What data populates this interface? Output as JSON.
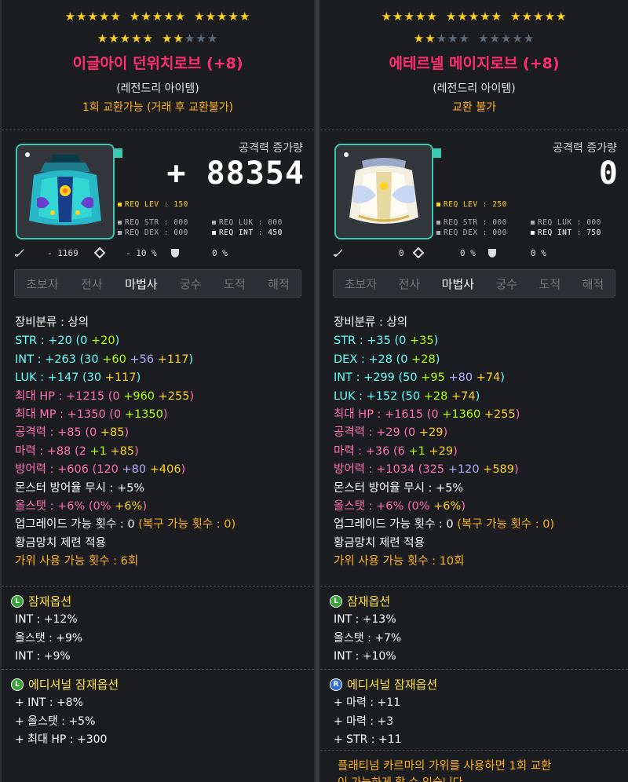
{
  "left": {
    "stars_row1_on": 15,
    "stars_row1_off": 0,
    "stars_row2_on": 7,
    "stars_row2_off": 3,
    "name": "이글아이 던위치로브 (+8)",
    "grade": "(레전드리 아이템)",
    "trade": "1회 교환가능 (거래 후 교환불가)",
    "atk_label": "공격력 증가량",
    "atk_value": "+ 88354",
    "req": {
      "lev": "REQ LEV : 150",
      "str": "REQ STR : 000",
      "luk": "REQ LUK : 000",
      "dex": "REQ DEX : 000",
      "int": "REQ INT : 450"
    },
    "mini": [
      "- 1169",
      "- 10 %",
      "0 %"
    ],
    "jobs": [
      "초보자",
      "전사",
      "마법사",
      "궁수",
      "도적",
      "해적"
    ],
    "stats": [
      [
        {
          "t": "장비분류 : 상의",
          "c": "white"
        }
      ],
      [
        {
          "t": "STR : +20 (0 ",
          "c": "cyan"
        },
        {
          "t": "+20",
          "c": "green"
        },
        {
          "t": ")",
          "c": "cyan"
        }
      ],
      [
        {
          "t": "INT : +263 (30 ",
          "c": "cyan"
        },
        {
          "t": "+60 ",
          "c": "green"
        },
        {
          "t": "+56 ",
          "c": "purple"
        },
        {
          "t": "+117",
          "c": "yellow"
        },
        {
          "t": ")",
          "c": "cyan"
        }
      ],
      [
        {
          "t": "LUK : +147 (30 ",
          "c": "cyan"
        },
        {
          "t": "+117",
          "c": "yellow"
        },
        {
          "t": ")",
          "c": "cyan"
        }
      ],
      [
        {
          "t": "최대 HP : +1215 (0 ",
          "c": "pink"
        },
        {
          "t": "+960 ",
          "c": "green"
        },
        {
          "t": "+255",
          "c": "yellow"
        },
        {
          "t": ")",
          "c": "pink"
        }
      ],
      [
        {
          "t": "최대 MP : +1350 (0 ",
          "c": "pink"
        },
        {
          "t": "+1350",
          "c": "green"
        },
        {
          "t": ")",
          "c": "pink"
        }
      ],
      [
        {
          "t": "공격력 : +85 (0 ",
          "c": "pink"
        },
        {
          "t": "+85",
          "c": "yellow"
        },
        {
          "t": ")",
          "c": "pink"
        }
      ],
      [
        {
          "t": "마력 : +88 (2 ",
          "c": "pink"
        },
        {
          "t": "+1 ",
          "c": "green"
        },
        {
          "t": "+85",
          "c": "yellow"
        },
        {
          "t": ")",
          "c": "pink"
        }
      ],
      [
        {
          "t": "방어력 : +606 (120 ",
          "c": "pink"
        },
        {
          "t": "+80 ",
          "c": "purple"
        },
        {
          "t": "+406",
          "c": "yellow"
        },
        {
          "t": ")",
          "c": "pink"
        }
      ],
      [
        {
          "t": "몬스터 방어율 무시 : +5%",
          "c": "white"
        }
      ],
      [
        {
          "t": "올스탯 : +6% (0% ",
          "c": "pink"
        },
        {
          "t": "+6%",
          "c": "yellow"
        },
        {
          "t": ")",
          "c": "pink"
        }
      ],
      [
        {
          "t": "업그레이드 가능 횟수 : 0 ",
          "c": "white"
        },
        {
          "t": "(복구 가능 횟수 : 0)",
          "c": "orange"
        }
      ],
      [
        {
          "t": "황금망치 제련 적용",
          "c": "white"
        }
      ],
      [
        {
          "t": "가위 사용 가능 횟수 : 6회",
          "c": "orange"
        }
      ]
    ],
    "potential_label": "잠재옵션",
    "potential_badge": "L",
    "potential": [
      "INT : +12%",
      "올스탯 : +9%",
      "INT : +9%"
    ],
    "additional_label": "에디셔널 잠재옵션",
    "additional_badge": "L",
    "additional": [
      "+ INT : +8%",
      "+ 올스탯 : +5%",
      "+ 최대 HP : +300"
    ]
  },
  "right": {
    "stars_row1_on": 15,
    "stars_row1_off": 0,
    "stars_row2_on": 2,
    "stars_row2_off": 8,
    "name": "에테르넬 메이지로브 (+8)",
    "grade": "(레전드리 아이템)",
    "trade": "교환 불가",
    "atk_label": "공격력 증가량",
    "atk_value": "0",
    "req": {
      "lev": "REQ LEV : 250",
      "str": "REQ STR : 000",
      "luk": "REQ LUK : 000",
      "dex": "REQ DEX : 000",
      "int": "REQ INT : 750"
    },
    "mini": [
      "0",
      "0 %",
      "0 %"
    ],
    "jobs": [
      "초보자",
      "전사",
      "마법사",
      "궁수",
      "도적",
      "해적"
    ],
    "stats": [
      [
        {
          "t": "장비분류 : 상의",
          "c": "white"
        }
      ],
      [
        {
          "t": "STR : +35 (0 ",
          "c": "cyan"
        },
        {
          "t": "+35",
          "c": "green"
        },
        {
          "t": ")",
          "c": "cyan"
        }
      ],
      [
        {
          "t": "DEX : +28 (0 ",
          "c": "cyan"
        },
        {
          "t": "+28",
          "c": "green"
        },
        {
          "t": ")",
          "c": "cyan"
        }
      ],
      [
        {
          "t": "INT : +299 (50 ",
          "c": "cyan"
        },
        {
          "t": "+95 ",
          "c": "green"
        },
        {
          "t": "+80 ",
          "c": "purple"
        },
        {
          "t": "+74",
          "c": "yellow"
        },
        {
          "t": ")",
          "c": "cyan"
        }
      ],
      [
        {
          "t": "LUK : +152 (50 ",
          "c": "cyan"
        },
        {
          "t": "+28 ",
          "c": "green"
        },
        {
          "t": "+74",
          "c": "yellow"
        },
        {
          "t": ")",
          "c": "cyan"
        }
      ],
      [
        {
          "t": "최대 HP : +1615 (0 ",
          "c": "pink"
        },
        {
          "t": "+1360 ",
          "c": "green"
        },
        {
          "t": "+255",
          "c": "yellow"
        },
        {
          "t": ")",
          "c": "pink"
        }
      ],
      [
        {
          "t": "공격력 : +29 (0 ",
          "c": "pink"
        },
        {
          "t": "+29",
          "c": "yellow"
        },
        {
          "t": ")",
          "c": "pink"
        }
      ],
      [
        {
          "t": "마력 : +36 (6 ",
          "c": "pink"
        },
        {
          "t": "+1 ",
          "c": "green"
        },
        {
          "t": "+29",
          "c": "yellow"
        },
        {
          "t": ")",
          "c": "pink"
        }
      ],
      [
        {
          "t": "방어력 : +1034 (325 ",
          "c": "pink"
        },
        {
          "t": "+120 ",
          "c": "purple"
        },
        {
          "t": "+589",
          "c": "yellow"
        },
        {
          "t": ")",
          "c": "pink"
        }
      ],
      [
        {
          "t": "몬스터 방어율 무시 : +5%",
          "c": "white"
        }
      ],
      [
        {
          "t": "올스탯 : +6% (0% ",
          "c": "pink"
        },
        {
          "t": "+6%",
          "c": "yellow"
        },
        {
          "t": ")",
          "c": "pink"
        }
      ],
      [
        {
          "t": "업그레이드 가능 횟수 : 0 ",
          "c": "white"
        },
        {
          "t": "(복구 가능 횟수 : 0)",
          "c": "orange"
        }
      ],
      [
        {
          "t": "황금망치 제련 적용",
          "c": "white"
        }
      ],
      [
        {
          "t": "가위 사용 가능 횟수 : 10회",
          "c": "orange"
        }
      ]
    ],
    "potential_label": "잠재옵션",
    "potential_badge": "L",
    "potential": [
      "INT : +13%",
      "올스탯 : +7%",
      "INT : +10%"
    ],
    "additional_label": "에디셔널 잠재옵션",
    "additional_badge": "R",
    "additional": [
      "+ 마력 : +11",
      "+ 마력 : +3",
      "+ STR : +11"
    ],
    "footer": "플래티넘 카르마의 가위를 사용하면 1회 교환",
    "footer2": "이 가능하게 할 수 있습니다."
  }
}
